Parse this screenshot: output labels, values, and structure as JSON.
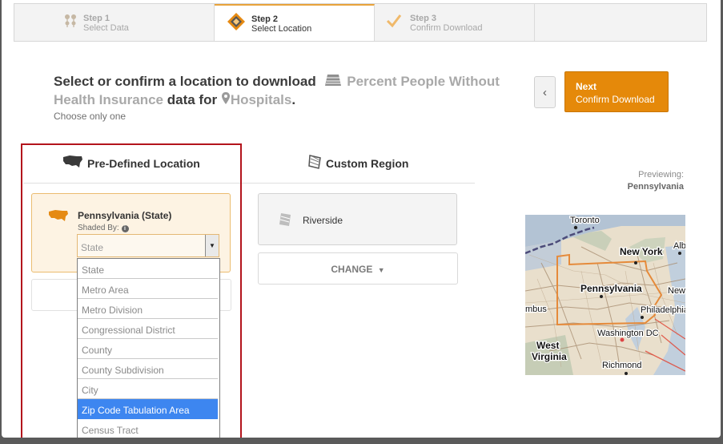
{
  "steps": [
    {
      "title": "Step 1",
      "subtitle": "Select Data",
      "icon": "map-pins-icon"
    },
    {
      "title": "Step 2",
      "subtitle": "Select Location",
      "icon": "location-cube-icon"
    },
    {
      "title": "Step 3",
      "subtitle": "Confirm Download",
      "icon": "checkmark-icon"
    }
  ],
  "heading": {
    "part1": "Select or confirm a location to download",
    "dataset": "Percent People Without Health Insurance",
    "part2": "data for",
    "entity": "Hospitals",
    "end": "."
  },
  "hint": "Choose only one",
  "next": {
    "label": "Next",
    "sublabel": "Confirm Download"
  },
  "tabs": {
    "predefined": "Pre-Defined Location",
    "custom": "Custom Region"
  },
  "location": {
    "name": "Pennsylvania (State)",
    "shaded_by_label": "Shaded By:",
    "selected": "State",
    "options": [
      "State",
      "Metro Area",
      "Metro Division",
      "Congressional District",
      "County",
      "County Subdivision",
      "City",
      "Zip Code Tabulation Area",
      "Census Tract"
    ],
    "highlighted_option": "Zip Code Tabulation Area"
  },
  "custom_region": {
    "name": "Riverside",
    "change_label": "CHANGE"
  },
  "preview": {
    "label": "Previewing:",
    "value": "Pennsylvania"
  },
  "map_labels": {
    "toronto": "Toronto",
    "new_york": "New York",
    "alb": "Alb",
    "pennsylvania": "Pennsylvania",
    "new": "New",
    "mbus": "mbus",
    "philadelphia": "Philadelphia",
    "washington": "Washington DC",
    "west": "West",
    "virginia": "Virginia",
    "richmond": "Richmond"
  },
  "colors": {
    "accent": "#e5890a",
    "highlight_border": "#b3141c",
    "selection": "#3d86f0"
  }
}
